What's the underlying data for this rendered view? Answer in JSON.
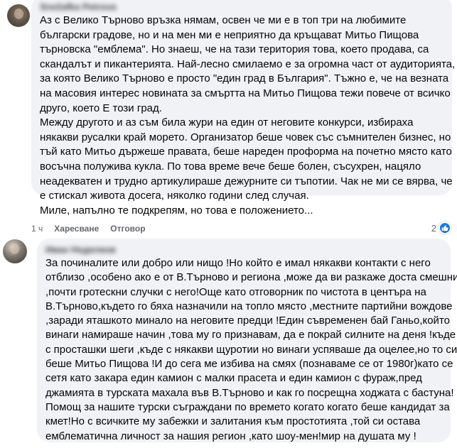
{
  "comments": [
    {
      "author": "Snežafka Petrova",
      "lines": [
        "Аз с Велико Търново връзка нямам, освен че ми е в топ три на любимите",
        "български градове, но и на мен ми е неприятно да кръщават Митьо Пищова",
        "търновска \"емблема\". Но знаеш, че на тази територия това, което продава, са",
        "скандалът и пикантерията. Най-лесно смилаемо е за огромна част от аудиторията,",
        "за която Велико Търново е просто \"един град в България\". Тъжно е, че на везната",
        "на масовия интерес новината за смъртта на Митьо Пищова тежи повече от всичко",
        "друго, което Е този град.",
        "Между другото и аз съм била жури на един от неговите конкурси, избирахa",
        "някакви русалки край морето. Организатор беше човек със съмнителен бизнес, но",
        "тъй като Митьо държеше правата, беше нареден проформа на почетно място като",
        "восъчна полужива кукла. По това време вече беше болен, съсухрен, нацяло",
        "неадекватен и трудно артикулираше дежурните си тъпотии. Чак не ми се вярва, че",
        "е стискал живота досега, няколко години след случая.",
        "Миле, напълно те подкрепям, но това е положението..."
      ],
      "time": "1 ч",
      "like_label": "Харесване",
      "reply_label": "Отговор",
      "reaction_count": "2"
    },
    {
      "author": "Иван Недялков",
      "lines": [
        "За починалите или добро или нищо !Но който е имал някакви контакти с него",
        "отблизо ,особено ако е от В.Търново и региона ,може да ви разкаже доста смешни",
        ",почти гротескни случки с него!Още като отговорник по чистота в центъра на",
        "В.Търново,където го бяха назначили на топло място ,местните партийни вождове",
        ",заради яташкото минало на неговите предци !Един съвременен бай Ганьо,който",
        "винаги намираше начин ,това му го признавам, да е покрай силните на деня !къде",
        "с просташки шеги ,къде с някакви щуротии но винаги успяваше да оцелее,но то си",
        "беше Митьо Пищова !И до сега ме избива на смях (познаваме се от 1980г)като се",
        "сетя като закара един камион с малки прасета и един камион с фураж,пред",
        "джамията в турската махала във В.Търново и как го посрещна ходжата с бастуна!",
        "Помощ за нашите турски съграждани по времето когато когато беше кандидат за",
        "кмет!Но с всичките му забежки и залитания към простотията ,той си остава",
        "емблематична личност за нашия регион ,като шоу-мен!мир на душата му !"
      ]
    }
  ],
  "colors": {
    "bubble_bg": "#f0f2f5",
    "meta_text": "#65676b",
    "like_blue": "#1b86f5"
  },
  "icons": {
    "like_badge": "thumbs-up-icon"
  }
}
